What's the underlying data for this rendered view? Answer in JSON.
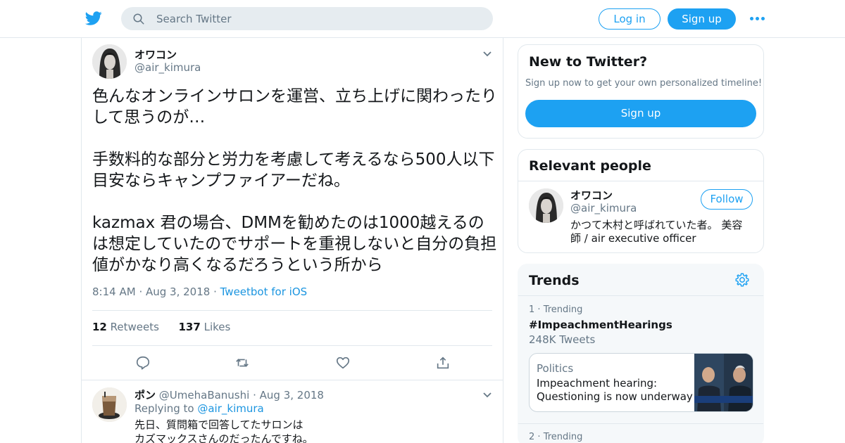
{
  "header": {
    "search_placeholder": "Search Twitter",
    "login_label": "Log in",
    "signup_label": "Sign up"
  },
  "tweet": {
    "display_name": "オワコン",
    "handle": "@air_kimura",
    "paragraphs": [
      "色んなオンラインサロンを運営、立ち上げに関わったりして思うのが…",
      "手数料的な部分と労力を考慮して考えるなら500人以下目安ならキャンプファイアーだね。",
      "kazmax 君の場合、DMMを勧めたのは1000越えるのは想定していたのでサポートを重視しないと自分の負担値がかなり高くなるだろうという所から"
    ],
    "time": "8:14 AM",
    "date": "Aug 3, 2018",
    "source": "Tweetbot for iOS",
    "retweets_count": "12",
    "retweets_label": "Retweets",
    "likes_count": "137",
    "likes_label": "Likes"
  },
  "reply": {
    "display_name": "ポン",
    "handle": "@UmehaBanushi",
    "date": "Aug 3, 2018",
    "replying_prefix": "Replying to",
    "replying_to": "@air_kimura",
    "line1": "先日、質問箱で回答してたサロンは",
    "line2": "カズマックスさんのだったんですね。"
  },
  "sidebar": {
    "new_to_twitter": {
      "title": "New to Twitter?",
      "subtitle": "Sign up now to get your own personalized timeline!",
      "button": "Sign up"
    },
    "relevant_people": {
      "title": "Relevant people",
      "name": "オワコン",
      "handle": "@air_kimura",
      "follow_label": "Follow",
      "bio_line1": "かつて木村と呼ばれていた者。 美容",
      "bio_line2": "師 / air executive officer"
    },
    "trends": {
      "title": "Trends",
      "items": [
        {
          "rank": "1",
          "label": "Trending",
          "tag": "#ImpeachmentHearings",
          "count": "248K Tweets",
          "news_category": "Politics",
          "news_title_line1": "Impeachment hearing:",
          "news_title_line2": "Questioning is now underway …"
        },
        {
          "rank": "2",
          "label": "Trending"
        }
      ]
    }
  },
  "colors": {
    "accent": "#1da1f2",
    "link": "#1b95e0",
    "muted": "#657786",
    "border": "#e1e8ed"
  }
}
